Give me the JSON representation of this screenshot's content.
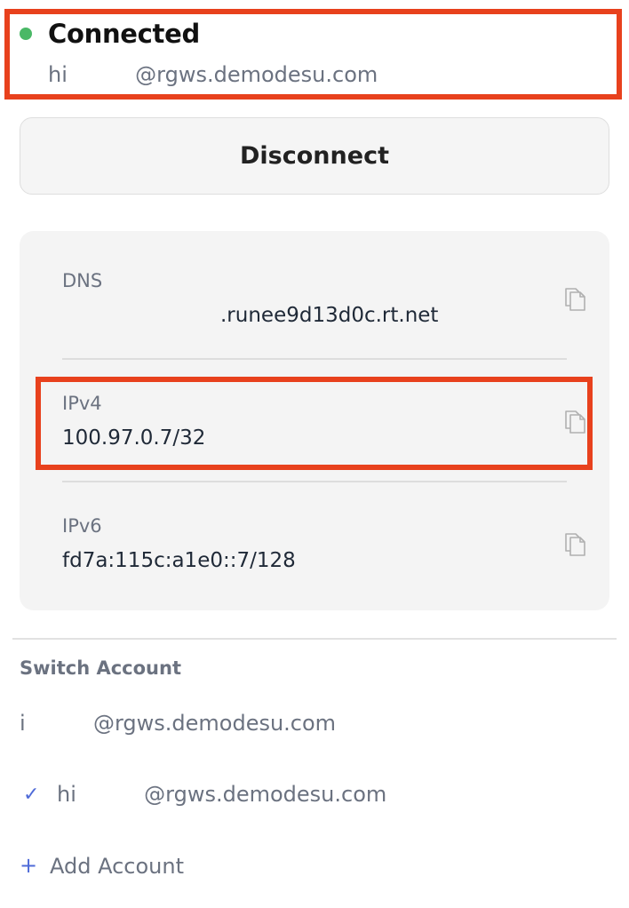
{
  "status": {
    "label": "Connected",
    "email": "hi          @rgws.demodesu.com",
    "dot_color": "#4ab866"
  },
  "disconnect_button": {
    "label": "Disconnect"
  },
  "network_info": {
    "dns": {
      "label": "DNS",
      "value": ".runee9d13d0c.rt.net"
    },
    "ipv4": {
      "label": "IPv4",
      "value": "100.97.0.7/32"
    },
    "ipv6": {
      "label": "IPv6",
      "value": "fd7a:115c:a1e0::7/128"
    },
    "copy_icon": "copy-icon"
  },
  "switch_account": {
    "heading": "Switch Account",
    "accounts": [
      {
        "email": "i          @rgws.demodesu.com",
        "selected": false
      },
      {
        "email": "hi          @rgws.demodesu.com",
        "selected": true,
        "check": "✓"
      }
    ],
    "add_account": {
      "icon": "+",
      "label": "Add Account"
    }
  },
  "colors": {
    "highlight": "#e8411d",
    "accent": "#4f6bd8"
  }
}
